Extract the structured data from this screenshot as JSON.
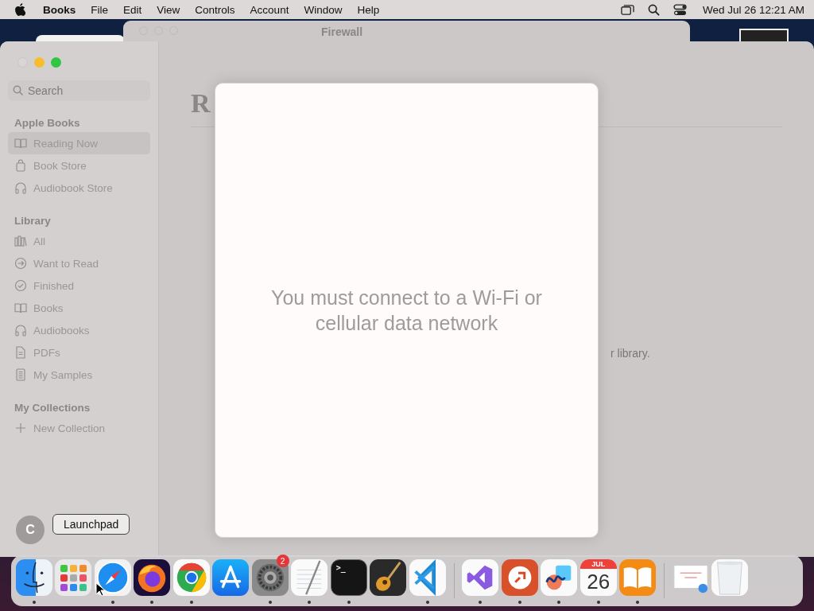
{
  "menu_bar": {
    "app_name": "Books",
    "menus": [
      "File",
      "Edit",
      "View",
      "Controls",
      "Account",
      "Window",
      "Help"
    ],
    "clock": "Wed Jul 26  12:21 AM"
  },
  "background_window": {
    "title": "Firewall"
  },
  "books_window": {
    "search": {
      "placeholder": "Search"
    },
    "sections": [
      {
        "title": "Apple Books",
        "items": [
          {
            "label": "Reading Now",
            "kind": "book",
            "selected": true
          },
          {
            "label": "Book Store",
            "kind": "bag",
            "selected": false
          },
          {
            "label": "Audiobook Store",
            "kind": "headphones",
            "selected": false
          }
        ]
      },
      {
        "title": "Library",
        "items": [
          {
            "label": "All",
            "kind": "shelf",
            "selected": false
          },
          {
            "label": "Want to Read",
            "kind": "arrow",
            "selected": false
          },
          {
            "label": "Finished",
            "kind": "check",
            "selected": false
          },
          {
            "label": "Books",
            "kind": "book",
            "selected": false
          },
          {
            "label": "Audiobooks",
            "kind": "headphones",
            "selected": false
          },
          {
            "label": "PDFs",
            "kind": "doc",
            "selected": false
          },
          {
            "label": "My Samples",
            "kind": "sample",
            "selected": false
          }
        ]
      },
      {
        "title": "My Collections",
        "items": [
          {
            "label": "New Collection",
            "kind": "plus",
            "selected": false
          }
        ]
      }
    ],
    "account_initial": "C",
    "heading": "R",
    "library_text": "r library."
  },
  "dialog": {
    "message": "You must connect to a Wi-Fi or cellular data network"
  },
  "tooltip": "Launchpad",
  "dock": [
    {
      "kind": "finder",
      "running": true
    },
    {
      "kind": "launchpad",
      "running": false
    },
    {
      "kind": "safari",
      "running": true
    },
    {
      "kind": "firefox",
      "running": true
    },
    {
      "kind": "chrome",
      "running": true
    },
    {
      "kind": "appstore",
      "running": false
    },
    {
      "kind": "settings",
      "running": true,
      "badge": "2"
    },
    {
      "kind": "textedit",
      "running": true
    },
    {
      "kind": "terminal",
      "running": true,
      "label": ">_"
    },
    {
      "kind": "guitar",
      "running": false
    },
    {
      "kind": "vscode",
      "running": true
    },
    {
      "kind": "separator"
    },
    {
      "kind": "visualstudio",
      "running": true
    },
    {
      "kind": "remote",
      "running": true
    },
    {
      "kind": "freeform",
      "running": true
    },
    {
      "kind": "calendar",
      "running": true,
      "month": "JUL",
      "day": "26"
    },
    {
      "kind": "books",
      "running": true
    },
    {
      "kind": "separator"
    },
    {
      "kind": "document",
      "running": false
    },
    {
      "kind": "trash",
      "running": false
    }
  ]
}
